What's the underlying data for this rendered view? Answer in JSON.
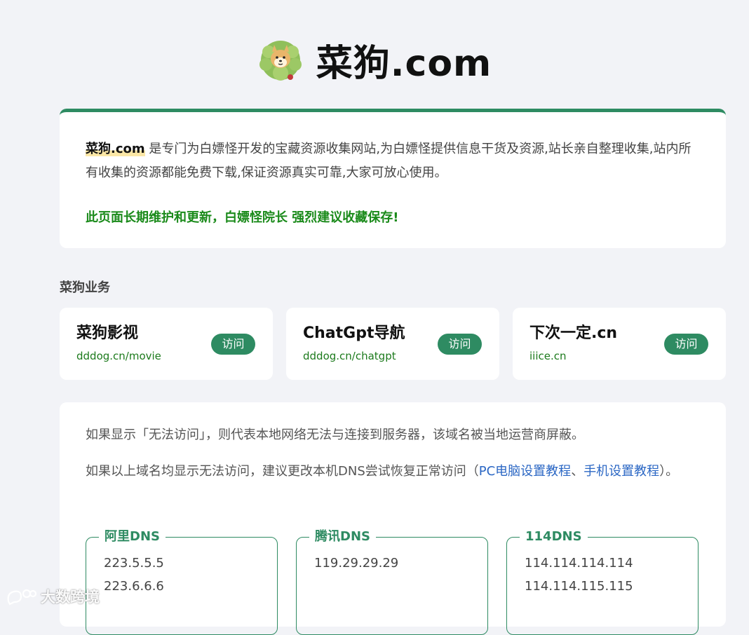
{
  "header": {
    "logo_icon": "cartoon-cabbage-dog-logo",
    "site_title": "菜狗.com"
  },
  "intro": {
    "brand": "菜狗.com",
    "description": " 是专门为白嫖怪开发的宝藏资源收集网站,为白嫖怪提供信息干货及资源,站长亲自整理收集,站内所有收集的资源都能免费下载,保证资源真实可靠,大家可放心使用。",
    "notice": "此页面长期维护和更新，白嫖怪院长 强烈建议收藏保存!"
  },
  "services": {
    "section_label": "菜狗业务",
    "items": [
      {
        "title": "菜狗影视",
        "url": "dddog.cn/movie",
        "button": "访问"
      },
      {
        "title": "ChatGpt导航",
        "url": "dddog.cn/chatgpt",
        "button": "访问"
      },
      {
        "title": "下次一定.cn",
        "url": "iiice.cn",
        "button": "访问"
      }
    ]
  },
  "info": {
    "line1": "如果显示「无法访问」，则代表本地网络无法与连接到服务器，该域名被当地运营商屏蔽。",
    "line2_prefix": "如果以上域名均显示无法访问，建议更改本机DNS尝试恢复正常访问（",
    "pc_link": "PC电脑设置教程",
    "separator": "、",
    "mobile_link": "手机设置教程",
    "line2_suffix": "）。",
    "dns": [
      {
        "name": "阿里DNS",
        "ips": [
          "223.5.5.5",
          "223.6.6.6"
        ]
      },
      {
        "name": "腾讯DNS",
        "ips": [
          "119.29.29.29"
        ]
      },
      {
        "name": "114DNS",
        "ips": [
          "114.114.114.114",
          "114.114.115.115"
        ]
      }
    ]
  },
  "watermark": {
    "text": "大数跨境",
    "icon": "brand-bubble-icon"
  },
  "colors": {
    "accent": "#2e8b62",
    "notice": "#1a8a1a",
    "link": "#2b67c4",
    "background": "#f2f3f7"
  }
}
